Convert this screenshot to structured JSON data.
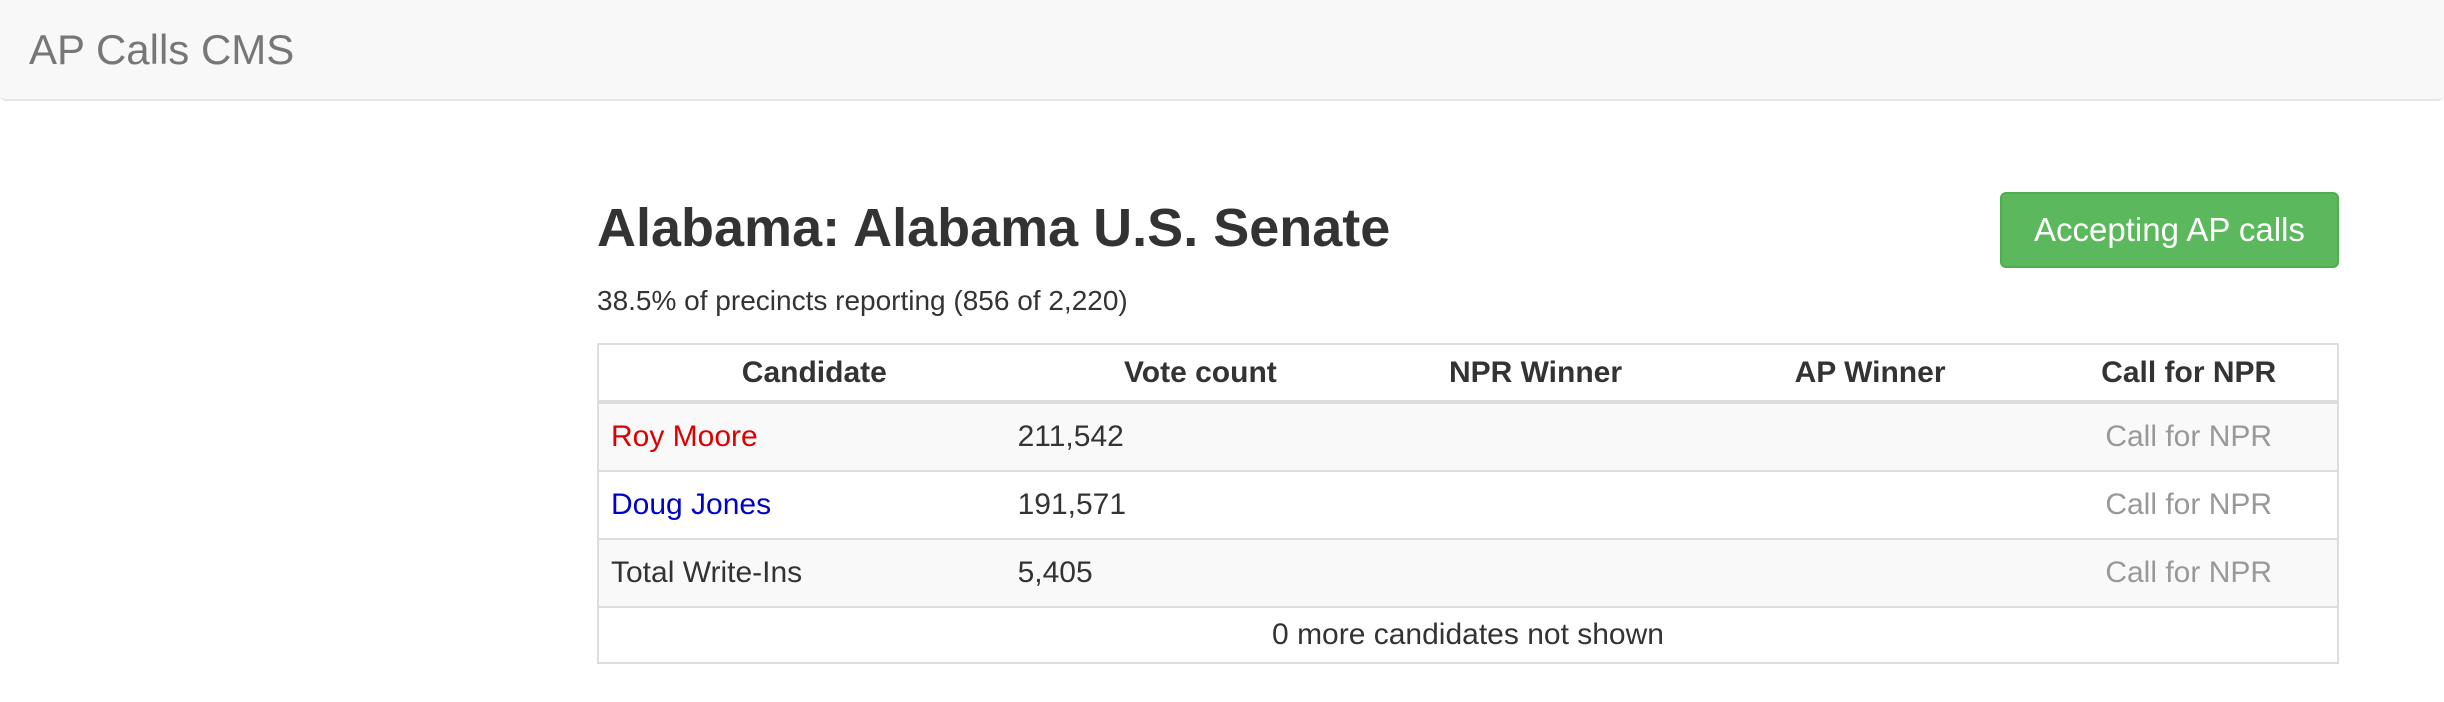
{
  "navbar": {
    "brand": "AP Calls CMS"
  },
  "race": {
    "title": "Alabama: Alabama U.S. Senate",
    "reporting": "38.5% of precincts reporting (856 of 2,220)",
    "accept_button_label": "Accepting AP calls"
  },
  "table": {
    "headers": {
      "candidate": "Candidate",
      "votes": "Vote count",
      "npr_winner": "NPR Winner",
      "ap_winner": "AP Winner",
      "call": "Call for NPR"
    },
    "rows": [
      {
        "name": "Roy Moore",
        "votes": "211,542",
        "npr_winner": "",
        "ap_winner": "",
        "call_label": "Call for NPR"
      },
      {
        "name": "Doug Jones",
        "votes": "191,571",
        "npr_winner": "",
        "ap_winner": "",
        "call_label": "Call for NPR"
      },
      {
        "name": "Total Write-Ins",
        "votes": "5,405",
        "npr_winner": "",
        "ap_winner": "",
        "call_label": "Call for NPR"
      }
    ],
    "more_candidates": "0 more candidates not shown"
  },
  "colors": {
    "accept_button": "#5cb85c",
    "gop": "#dd0000",
    "dem": "#0000cc",
    "call_text": "#999999"
  }
}
